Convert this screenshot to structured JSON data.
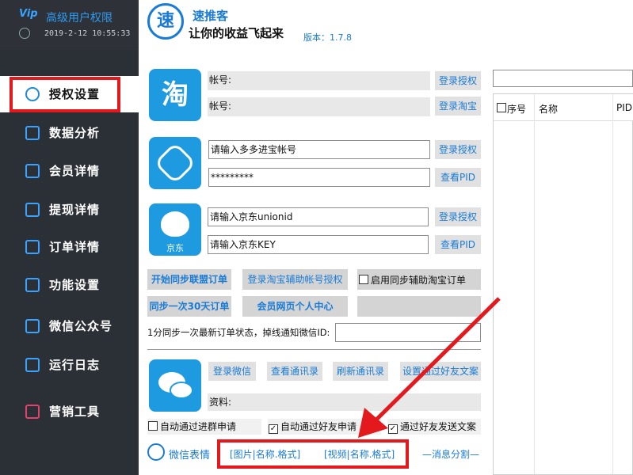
{
  "app": {
    "title": "高级用户权限",
    "datetime": "2019-2-12 10:55:33",
    "name": "速推客",
    "slogan": "让你的收益飞起来",
    "version": "版本：1.7.8",
    "logo_char": "速",
    "vip_badge": "Vip"
  },
  "nav": [
    {
      "label": "授权设置",
      "icon": "globe-icon"
    },
    {
      "label": "数据分析",
      "icon": "chart-icon"
    },
    {
      "label": "会员详情",
      "icon": "edit-icon"
    },
    {
      "label": "提现详情",
      "icon": "grid-search-icon"
    },
    {
      "label": "订单详情",
      "icon": "clipboard-icon"
    },
    {
      "label": "功能设置",
      "icon": "chat-gear-icon"
    },
    {
      "label": "微信公众号",
      "icon": "wechat-public-icon"
    },
    {
      "label": "运行日志",
      "icon": "speaker-icon"
    },
    {
      "label": "营销工具",
      "icon": "bar-chart-icon"
    }
  ],
  "taobao": {
    "account_label": "帐号:",
    "account2_label": "帐号:",
    "login_auth": "登录授权",
    "login_taobao": "登录淘宝",
    "logo_char": "淘"
  },
  "pdd": {
    "account_placeholder": "请输入多多进宝帐号",
    "password": "*********",
    "login_auth": "登录授权",
    "view_pid": "查看PID"
  },
  "jd": {
    "unionid_placeholder": "请输入京东unionid",
    "key_placeholder": "请输入京东KEY",
    "login_auth": "登录授权",
    "view_pid": "查看PID",
    "logo_text": "京东"
  },
  "sync": {
    "start_sync": "开始同步联盟订单",
    "login_aux": "登录淘宝辅助帐号授权",
    "enable_aux": "启用同步辅助淘宝订单",
    "sync30": "同步一次30天订单",
    "member_center": "会员网页个人中心",
    "notify_label": "1分同步一次最新订单状态，掉线通知微信ID:"
  },
  "wechat": {
    "login": "登录微信",
    "view_contacts": "查看通讯录",
    "refresh_contacts": "刷新通讯录",
    "set_friend_text": "设置通过好友文案",
    "info_label": "资料:",
    "auto_group": "自动通过进群申请",
    "auto_friend": "自动通过好友申请",
    "send_text": "通过好友发送文案",
    "emoji_label": "微信表情",
    "image_fmt": "[图片|名称.格式]",
    "video_fmt": "[视频|名称.格式]",
    "msg_split": "—消息分割—"
  },
  "table": {
    "headers": [
      "序号",
      "名称",
      "PID"
    ]
  }
}
